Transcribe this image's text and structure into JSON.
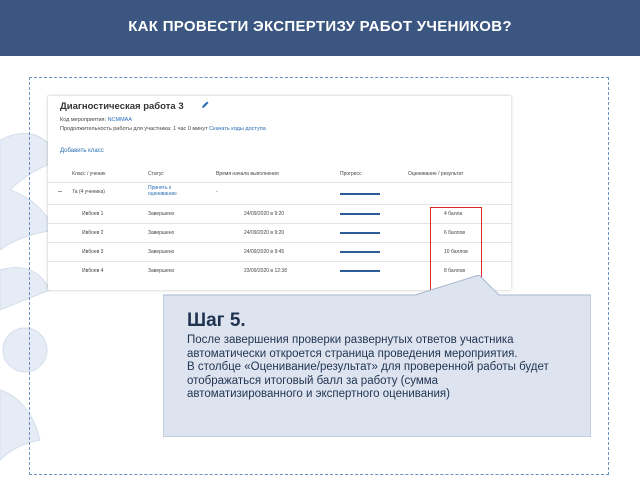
{
  "header": {
    "title": "КАК ПРОВЕСТИ ЭКСПЕРТИЗУ РАБОТ УЧЕНИКОВ?"
  },
  "screenshot": {
    "title": "Диагностическая работа 3",
    "event_code_label": "Код мероприятия:",
    "event_code_value": "NCMMAA",
    "duration_label": "Продолжительность работы для участника: 1 час 0 минут",
    "access_link": "Скачать коды доступа",
    "add_class": "Добавить класс",
    "columns": [
      "Класс / ученик",
      "Статус",
      "Время начала выполнения",
      "Прогресс",
      "Оценивание / результат"
    ],
    "group_row": {
      "toggle": "–",
      "name": "7а (4 ученика)",
      "status": "Принять к оцениванию",
      "time": "-"
    },
    "rows": [
      {
        "name": "Ивбоев 1",
        "status": "Завершено",
        "time": "24/09/2020 в 9:20",
        "progress": 1.0,
        "score": "4 балла"
      },
      {
        "name": "Ивбоев 2",
        "status": "Завершено",
        "time": "24/09/2020 в 9:20",
        "progress": 1.0,
        "score": "6 баллов"
      },
      {
        "name": "Ивбоев 3",
        "status": "Завершено",
        "time": "24/09/2020 в 9:45",
        "progress": 1.0,
        "score": "10 баллов"
      },
      {
        "name": "Ивбоев 4",
        "status": "Завершено",
        "time": "23/09/2020 в 12:38",
        "progress": 1.0,
        "score": "8 баллов"
      }
    ]
  },
  "callout": {
    "step": "Шаг 5.",
    "paragraph1": "После завершения проверки развернутых ответов участника автоматически откроется страница проведения мероприятия.",
    "paragraph2": "В столбце «Оценивание/результат» для проверенной работы будет отображаться итоговый балл за работу (сумма автоматизированного и экспертного оценивания)"
  },
  "colors": {
    "header": "#3b5680",
    "accent_red": "#d92a2a",
    "callout_bg": "#dde4f0",
    "link": "#2a6db5"
  }
}
